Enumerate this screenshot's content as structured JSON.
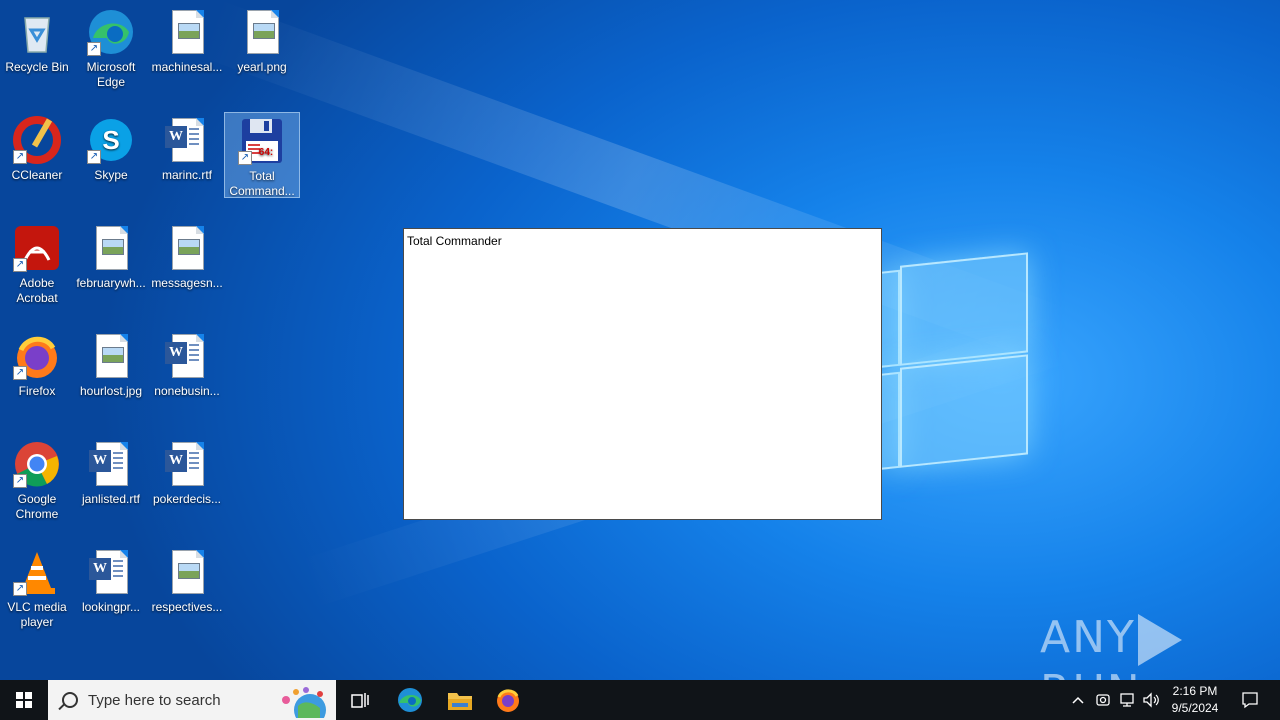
{
  "desktop": {
    "icons": [
      {
        "label": "Recycle Bin"
      },
      {
        "label": "Microsoft Edge"
      },
      {
        "label": "machinesal..."
      },
      {
        "label": "yearl.png"
      },
      {
        "label": "CCleaner"
      },
      {
        "label": "Skype"
      },
      {
        "label": "marinc.rtf"
      },
      {
        "label": "Total Command..."
      },
      {
        "label": "Adobe Acrobat"
      },
      {
        "label": "februarywh..."
      },
      {
        "label": "messagesn..."
      },
      {
        "label": "Firefox"
      },
      {
        "label": "hourlost.jpg"
      },
      {
        "label": "nonebusin..."
      },
      {
        "label": "Google Chrome"
      },
      {
        "label": "janlisted.rtf"
      },
      {
        "label": "pokerdecis..."
      },
      {
        "label": "VLC media player"
      },
      {
        "label": "lookingpr..."
      },
      {
        "label": "respectives..."
      }
    ]
  },
  "window": {
    "title": "Total Commander"
  },
  "watermark": {
    "left": "ANY",
    "right": "RUN"
  },
  "taskbar": {
    "search_placeholder": "Type here to search",
    "clock_time": "2:16 PM",
    "clock_date": "9/5/2024"
  },
  "colors": {
    "desktop_accent": "#1582ea",
    "taskbar": "#101418"
  }
}
